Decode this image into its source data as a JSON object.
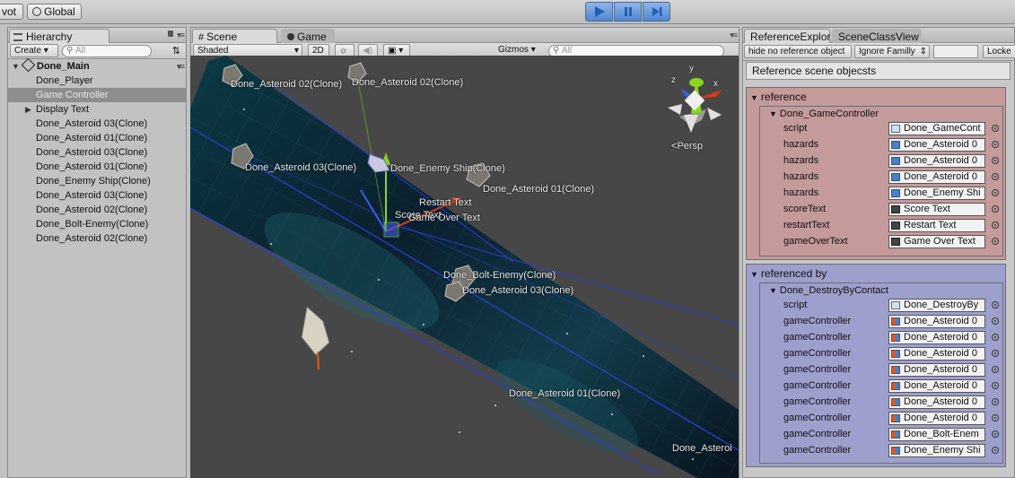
{
  "topbar": {
    "pivot_label": "vot",
    "global_label": "Global"
  },
  "hierarchy": {
    "tab_label": "Hierarchy",
    "create_label": "Create",
    "search_placeholder": "All",
    "root": "Done_Main",
    "items": [
      {
        "label": "Done_Player",
        "selected": false,
        "expandable": false
      },
      {
        "label": "Game Controller",
        "selected": true,
        "expandable": false
      },
      {
        "label": "Display Text",
        "selected": false,
        "expandable": true
      },
      {
        "label": "Done_Asteroid 03(Clone)",
        "selected": false,
        "expandable": false
      },
      {
        "label": "Done_Asteroid 01(Clone)",
        "selected": false,
        "expandable": false
      },
      {
        "label": "Done_Asteroid 03(Clone)",
        "selected": false,
        "expandable": false
      },
      {
        "label": "Done_Asteroid 01(Clone)",
        "selected": false,
        "expandable": false
      },
      {
        "label": "Done_Enemy Ship(Clone)",
        "selected": false,
        "expandable": false
      },
      {
        "label": "Done_Asteroid 03(Clone)",
        "selected": false,
        "expandable": false
      },
      {
        "label": "Done_Asteroid 02(Clone)",
        "selected": false,
        "expandable": false
      },
      {
        "label": "Done_Bolt-Enemy(Clone)",
        "selected": false,
        "expandable": false
      },
      {
        "label": "Done_Asteroid 02(Clone)",
        "selected": false,
        "expandable": false
      }
    ]
  },
  "scene": {
    "tab_scene": "Scene",
    "tab_game": "Game",
    "shading_mode": "Shaded",
    "mode_2d": "2D",
    "gizmos_label": "Gizmos",
    "search_placeholder": "All",
    "persp_label": "Persp",
    "axis_labels": {
      "y": "y",
      "x": "x",
      "z": "z"
    },
    "labels": [
      "Done_Asteroid 02(Clone)",
      "Done_Asteroid 02(Clone)",
      "Done_Asteroid 03(Clone)",
      "Done_Enemy Ship(Clone)",
      "Done_Asteroid 01(Clone)",
      "Restart Text",
      "Score Text",
      "Game Over Text",
      "Done_Bolt-Enemy(Clone)",
      "Done_Asteroid 03(Clone)",
      "Done_Asteroid 01(Clone)",
      "Done_Asteroi"
    ]
  },
  "ref_explorer": {
    "tab_label": "ReferenceExplor",
    "tab_other": "SceneClassView",
    "filter_label": "hide no reference object",
    "family_dropdown": "Ignore Familly",
    "lock_label": "Locke",
    "title_button": "Reference scene objecsts",
    "reference_header": "reference",
    "reference_object": "Done_GameController",
    "reference_fields": [
      {
        "label": "script",
        "value": "Done_GameCont",
        "icon": "script"
      },
      {
        "label": "hazards",
        "value": "Done_Asteroid 0",
        "icon": "prefab"
      },
      {
        "label": "hazards",
        "value": "Done_Asteroid 0",
        "icon": "prefab"
      },
      {
        "label": "hazards",
        "value": "Done_Asteroid 0",
        "icon": "prefab"
      },
      {
        "label": "hazards",
        "value": "Done_Enemy Shi",
        "icon": "prefab"
      },
      {
        "label": "scoreText",
        "value": "Score Text",
        "icon": "text"
      },
      {
        "label": "restartText",
        "value": "Restart Text",
        "icon": "text"
      },
      {
        "label": "gameOverText",
        "value": "Game Over Text",
        "icon": "text"
      }
    ],
    "referenced_by_header": "referenced by",
    "referenced_by_object": "Done_DestroyByContact",
    "referenced_by_fields": [
      {
        "label": "script",
        "value": "Done_DestroyBy",
        "icon": "script"
      },
      {
        "label": "gameController",
        "value": "Done_Asteroid 0",
        "icon": "component"
      },
      {
        "label": "gameController",
        "value": "Done_Asteroid 0",
        "icon": "component"
      },
      {
        "label": "gameController",
        "value": "Done_Asteroid 0",
        "icon": "component"
      },
      {
        "label": "gameController",
        "value": "Done_Asteroid 0",
        "icon": "component"
      },
      {
        "label": "gameController",
        "value": "Done_Asteroid 0",
        "icon": "component"
      },
      {
        "label": "gameController",
        "value": "Done_Asteroid 0",
        "icon": "component"
      },
      {
        "label": "gameController",
        "value": "Done_Asteroid 0",
        "icon": "component"
      },
      {
        "label": "gameController",
        "value": "Done_Bolt-Enem",
        "icon": "component"
      },
      {
        "label": "gameController",
        "value": "Done_Enemy Shi",
        "icon": "component"
      }
    ]
  },
  "colors": {
    "reference_bg": "#c49a9a",
    "referenced_by_bg": "#9d9fcc",
    "play_blue": "#4f86cf",
    "selection": "#8e8e8e"
  }
}
